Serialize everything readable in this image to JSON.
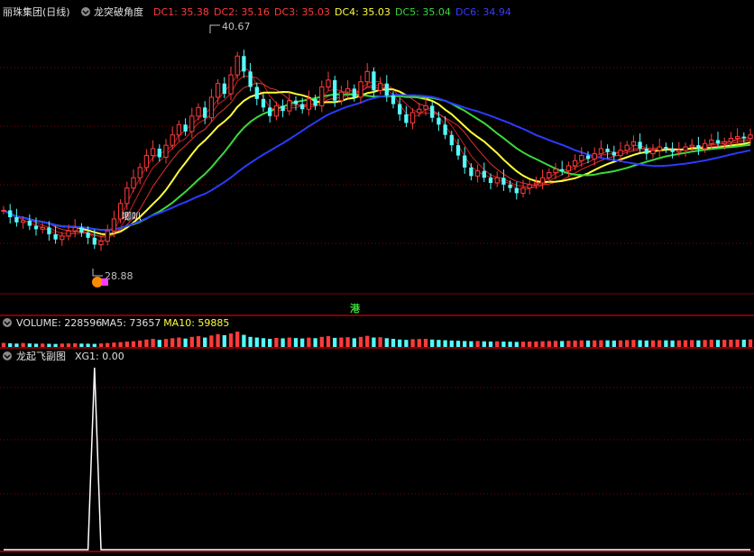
{
  "header": {
    "stock_name": "丽珠集团(日线)",
    "indicator_name": "龙突破角度",
    "dc_items": [
      {
        "label": "DC1: 35.38",
        "color": "#ff3b3b"
      },
      {
        "label": "DC2: 35.16",
        "color": "#ff3b3b"
      },
      {
        "label": "DC3: 35.03",
        "color": "#ff3b3b"
      },
      {
        "label": "DC4: 35.03",
        "color": "#ffff3b"
      },
      {
        "label": "DC5: 35.04",
        "color": "#3bd83b"
      },
      {
        "label": "DC6: 34.94",
        "color": "#3b3bff"
      }
    ]
  },
  "annotations": {
    "high_label": "40.67",
    "low_label": "28.88",
    "tag_text": "唧叭",
    "hk_tag": "港"
  },
  "volume_panel": {
    "items": [
      {
        "label": "VOLUME: 228596",
        "color": "#e0e0e0"
      },
      {
        "label": "MA5: 73657",
        "color": "#e0e0e0"
      },
      {
        "label": "MA10: 59885",
        "color": "#ffff3b"
      }
    ]
  },
  "sub_panel": {
    "title": "龙起飞副图",
    "xg_label": "XG1: 0.00"
  },
  "colors": {
    "up": "#ff3b3b",
    "down": "#54fcfc",
    "ma_yellow": "#ffff3b",
    "ma_green": "#3bd83b",
    "ma_blue": "#2a3bff",
    "grid": "#8b0000"
  },
  "chart_data": {
    "type": "candlestick",
    "price_range": [
      27.5,
      41.8
    ],
    "high": 40.67,
    "low": 28.88,
    "close_series": [
      31.0,
      30.6,
      30.3,
      30.4,
      30.1,
      29.9,
      30.0,
      29.6,
      29.3,
      29.5,
      29.8,
      30.0,
      29.7,
      29.4,
      29.0,
      29.2,
      29.8,
      30.5,
      31.4,
      32.3,
      32.9,
      33.5,
      34.2,
      34.6,
      34.1,
      34.8,
      35.4,
      36.0,
      35.6,
      36.5,
      37.0,
      36.4,
      37.6,
      38.4,
      37.8,
      38.9,
      40.0,
      39.1,
      38.2,
      37.5,
      37.0,
      36.5,
      37.1,
      36.8,
      37.4,
      37.2,
      36.9,
      37.5,
      37.1,
      38.2,
      38.6,
      37.4,
      37.9,
      38.1,
      37.6,
      38.5,
      39.1,
      38.0,
      38.4,
      37.7,
      37.2,
      36.6,
      36.1,
      36.7,
      36.9,
      37.1,
      36.4,
      36.0,
      35.4,
      34.8,
      34.2,
      33.5,
      33.0,
      33.3,
      32.9,
      32.6,
      32.9,
      32.5,
      32.3,
      32.0,
      32.3,
      32.5,
      32.6,
      32.9,
      33.2,
      33.4,
      33.3,
      33.6,
      33.9,
      34.2,
      34.0,
      34.3,
      34.6,
      34.4,
      34.2,
      34.5,
      34.8,
      35.0,
      34.6,
      34.3,
      34.5,
      34.7,
      34.6,
      34.4,
      34.5,
      34.7,
      34.8,
      34.6,
      34.9,
      35.1,
      34.9,
      35.0,
      35.2,
      35.3,
      35.2,
      35.4
    ],
    "series": [
      {
        "name": "DC1",
        "values": [
          35.38
        ]
      },
      {
        "name": "DC2",
        "values": [
          35.16
        ]
      },
      {
        "name": "DC3",
        "values": [
          35.03
        ]
      },
      {
        "name": "DC4",
        "values": [
          35.03
        ]
      },
      {
        "name": "DC5",
        "values": [
          35.04
        ]
      },
      {
        "name": "DC6",
        "values": [
          34.94
        ]
      }
    ],
    "volume": [
      60,
      55,
      50,
      58,
      52,
      48,
      50,
      47,
      45,
      50,
      52,
      55,
      50,
      48,
      46,
      52,
      58,
      65,
      72,
      80,
      85,
      95,
      110,
      120,
      105,
      118,
      130,
      140,
      125,
      150,
      160,
      140,
      170,
      190,
      175,
      200,
      228,
      180,
      150,
      140,
      130,
      120,
      135,
      128,
      140,
      132,
      126,
      138,
      130,
      150,
      160,
      135,
      140,
      145,
      130,
      150,
      165,
      140,
      145,
      130,
      120,
      110,
      105,
      115,
      118,
      120,
      110,
      105,
      100,
      95,
      92,
      88,
      85,
      88,
      84,
      80,
      84,
      80,
      78,
      75,
      78,
      80,
      82,
      85,
      88,
      90,
      88,
      92,
      95,
      98,
      95,
      98,
      100,
      98,
      95,
      98,
      102,
      105,
      100,
      96,
      98,
      100,
      98,
      96,
      98,
      100,
      102,
      98,
      104,
      108,
      104,
      106,
      108,
      110,
      108,
      112
    ],
    "xg1": [
      0,
      0,
      0,
      0,
      0,
      0,
      0,
      0,
      0,
      0,
      0,
      0,
      0,
      0,
      1,
      0,
      0,
      0,
      0,
      0,
      0,
      0,
      0,
      0,
      0,
      0,
      0,
      0,
      0,
      0,
      0,
      0,
      0,
      0,
      0,
      0,
      0,
      0,
      0,
      0,
      0,
      0,
      0,
      0,
      0,
      0,
      0,
      0,
      0,
      0,
      0,
      0,
      0,
      0,
      0,
      0,
      0,
      0,
      0,
      0,
      0,
      0,
      0,
      0,
      0,
      0,
      0,
      0,
      0,
      0,
      0,
      0,
      0,
      0,
      0,
      0,
      0,
      0,
      0,
      0,
      0,
      0,
      0,
      0,
      0,
      0,
      0,
      0,
      0,
      0,
      0,
      0,
      0,
      0,
      0,
      0,
      0,
      0,
      0,
      0,
      0,
      0,
      0,
      0,
      0,
      0,
      0,
      0,
      0,
      0,
      0,
      0,
      0,
      0,
      0,
      0
    ]
  }
}
